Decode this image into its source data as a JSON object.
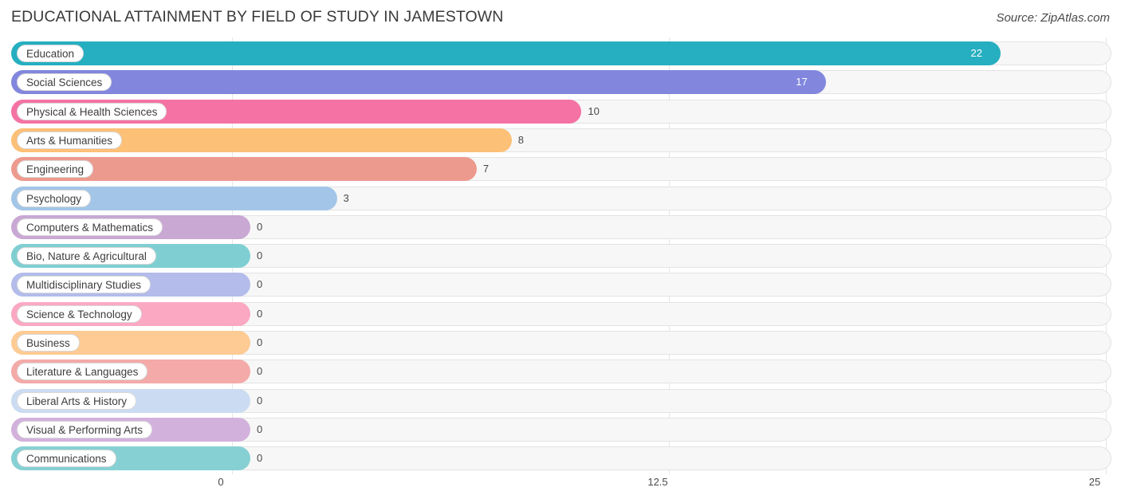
{
  "header": {
    "title": "EDUCATIONAL ATTAINMENT BY FIELD OF STUDY IN JAMESTOWN",
    "source": "Source: ZipAtlas.com"
  },
  "chart_data": {
    "type": "bar",
    "orientation": "horizontal",
    "title": "EDUCATIONAL ATTAINMENT BY FIELD OF STUDY IN JAMESTOWN",
    "xlabel": "",
    "ylabel": "",
    "xlim": [
      0,
      25
    ],
    "xticks": [
      "0",
      "12.5",
      "25"
    ],
    "xtick_values": [
      0,
      12.5,
      25
    ],
    "grid": true,
    "legend": "none",
    "categories": [
      "Education",
      "Social Sciences",
      "Physical & Health Sciences",
      "Arts & Humanities",
      "Engineering",
      "Psychology",
      "Computers & Mathematics",
      "Bio, Nature & Agricultural",
      "Multidisciplinary Studies",
      "Science & Technology",
      "Business",
      "Literature & Languages",
      "Liberal Arts & History",
      "Visual & Performing Arts",
      "Communications"
    ],
    "values": [
      22,
      17,
      10,
      8,
      7,
      3,
      0,
      0,
      0,
      0,
      0,
      0,
      0,
      0,
      0
    ],
    "value_labels": [
      "22",
      "17",
      "10",
      "8",
      "7",
      "3",
      "0",
      "0",
      "0",
      "0",
      "0",
      "0",
      "0",
      "0",
      "0"
    ],
    "colors": [
      "#26afc0",
      "#8287dd",
      "#f573a4",
      "#fdc077",
      "#ed9a8e",
      "#a3c6e8",
      "#c9a8d4",
      "#7fcfd2",
      "#b3bcea",
      "#fba8c2",
      "#fdcb93",
      "#f3aaa8",
      "#cbdcf2",
      "#d2b2dd",
      "#86d0d4"
    ]
  }
}
